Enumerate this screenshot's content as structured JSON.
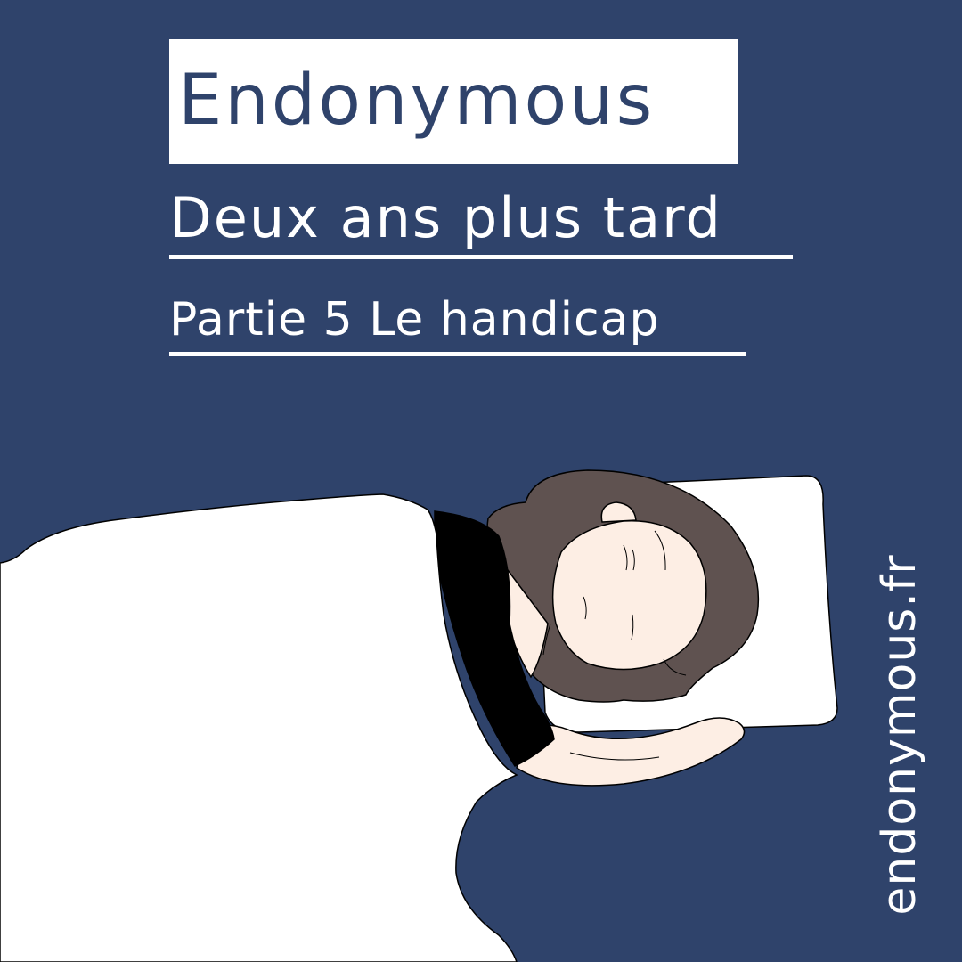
{
  "header": {
    "title": "Endonymous",
    "subtitle": "Deux ans plus tard",
    "part": "Partie 5 Le handicap"
  },
  "footer": {
    "site": "endonymous.fr"
  },
  "colors": {
    "background": "#2f436b",
    "blanket": "#ffffff",
    "hair": "#5f5250",
    "skin": "#fdeee4",
    "shirt": "#000000",
    "pillow": "#ffffff"
  }
}
